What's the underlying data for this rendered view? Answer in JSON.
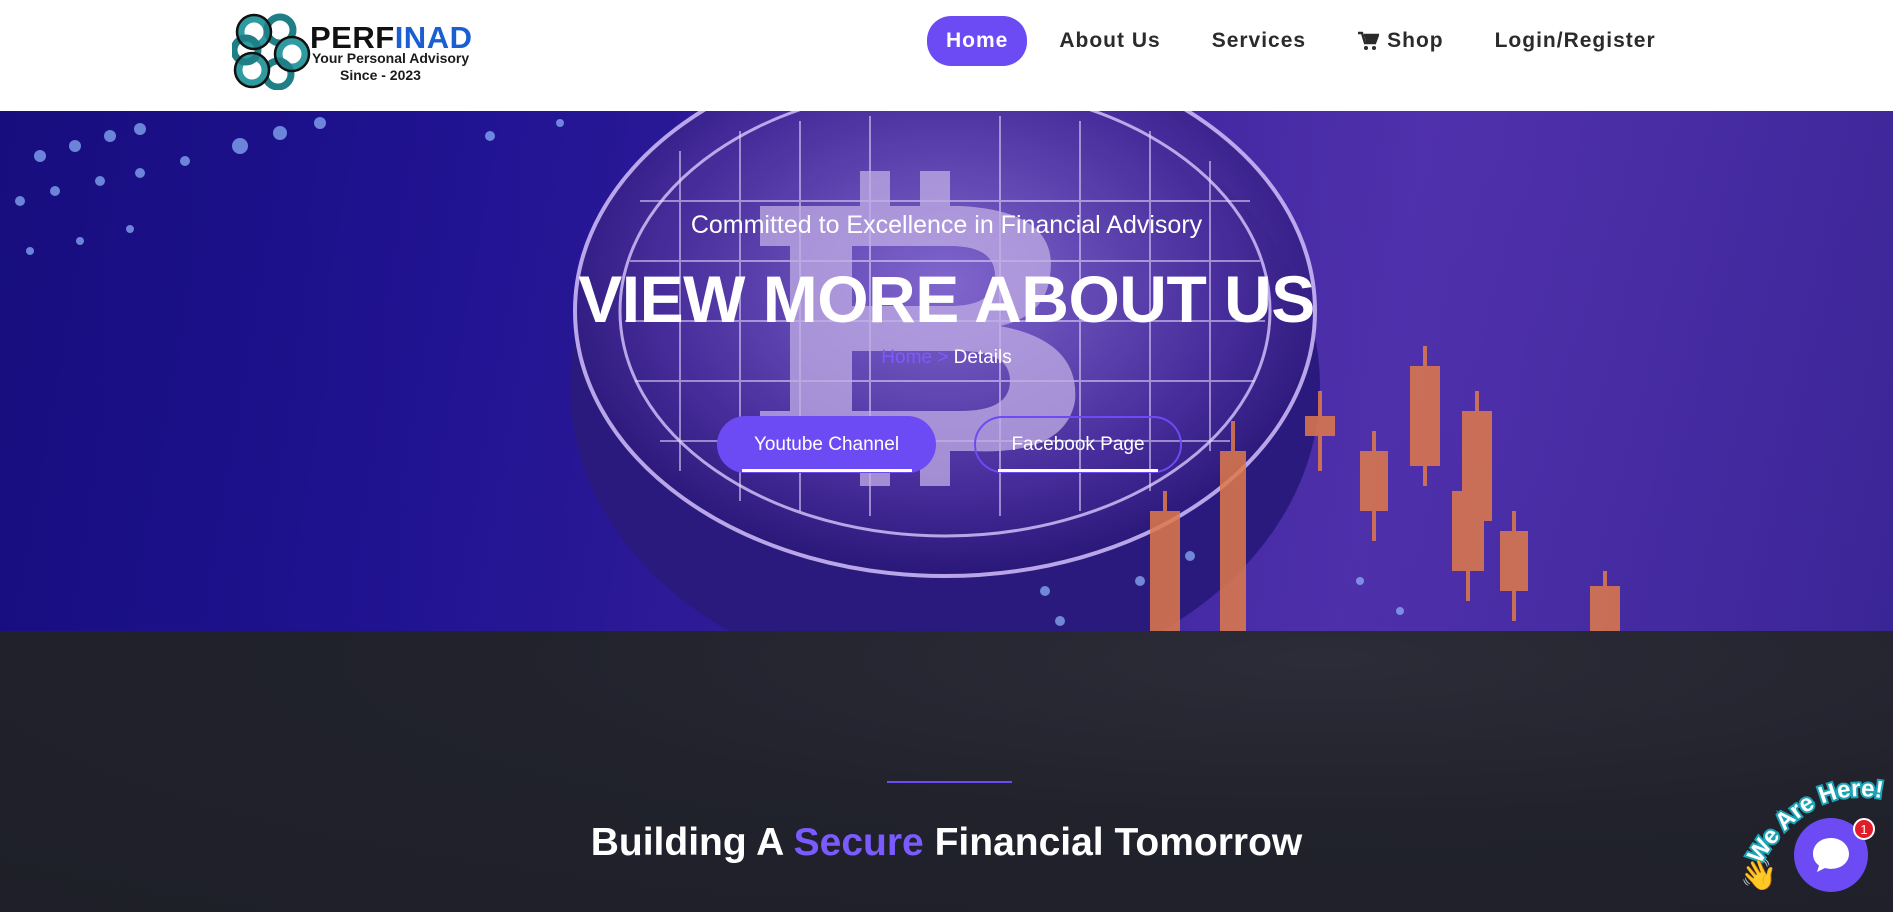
{
  "header": {
    "logo": {
      "brand_part1": "PERF",
      "brand_part2": "INAD",
      "tagline": "Your Personal Advisory",
      "since": "Since - 2023"
    },
    "nav": [
      {
        "label": "Home",
        "active": true
      },
      {
        "label": "About Us"
      },
      {
        "label": "Services"
      },
      {
        "label": "Shop",
        "icon": "cart-icon"
      },
      {
        "label": "Login/Register"
      }
    ]
  },
  "hero": {
    "subtitle": "Committed to Excellence in Financial Advisory",
    "title": "VIEW MORE ABOUT US",
    "breadcrumb": {
      "home": "Home",
      "separator": ">",
      "current": "Details"
    },
    "buttons": {
      "youtube": "Youtube Channel",
      "facebook": "Facebook Page"
    }
  },
  "section": {
    "title_part1": "Building A",
    "title_accent": "Secure",
    "title_part2": "Financial Tomorrow"
  },
  "chat_widget": {
    "label": "We Are Here!",
    "badge": "1",
    "icon": "chat-icon"
  },
  "colors": {
    "accent": "#6c4bf5",
    "dark_bg": "#21222c"
  }
}
